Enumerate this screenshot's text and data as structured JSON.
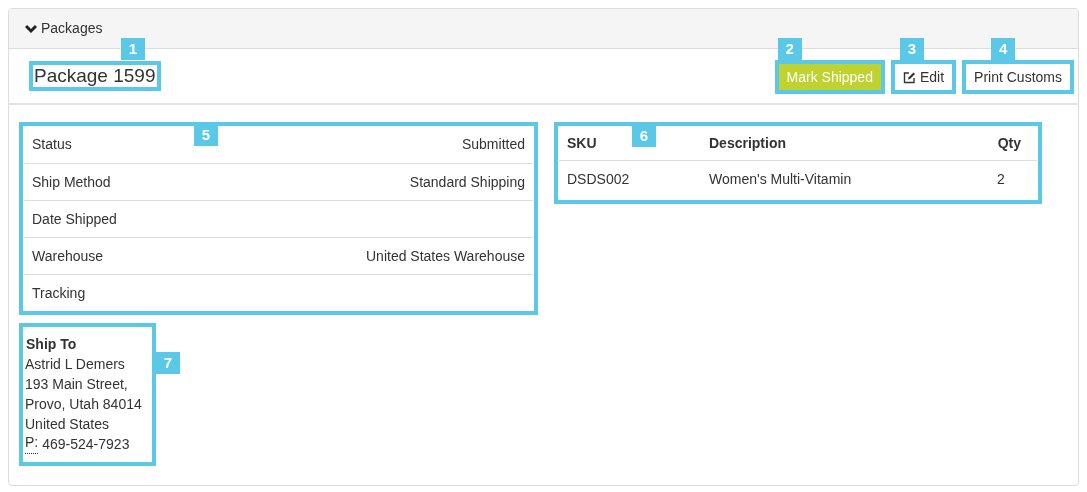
{
  "panel": {
    "heading": "Packages",
    "expanded": true
  },
  "package": {
    "title": "Package 1599",
    "callout": "1"
  },
  "actions": [
    {
      "label": "Mark Shipped",
      "kind": "primary",
      "callout": "2"
    },
    {
      "label": "Edit",
      "kind": "edit",
      "callout": "3"
    },
    {
      "label": "Print Customs",
      "kind": "default",
      "callout": "4"
    }
  ],
  "details": {
    "callout": "5",
    "rows": [
      {
        "label": "Status",
        "value": "Submitted"
      },
      {
        "label": "Ship Method",
        "value": "Standard Shipping"
      },
      {
        "label": "Date Shipped"
      },
      {
        "label": "Warehouse",
        "value": "United States Warehouse"
      },
      {
        "label": "Tracking"
      }
    ]
  },
  "items": {
    "callout": "6",
    "columns": [
      "SKU",
      "Description",
      "Qty"
    ],
    "rows": [
      [
        "DSDS002",
        "Women's Multi-Vitamin",
        "2"
      ]
    ]
  },
  "ship_to": {
    "callout": "7",
    "heading": "Ship To",
    "lines": [
      "Astrid L Demers",
      "193 Main Street,",
      "Provo, Utah 84014",
      "United States"
    ],
    "phone_label": "P:",
    "phone": "469-524-7923"
  }
}
